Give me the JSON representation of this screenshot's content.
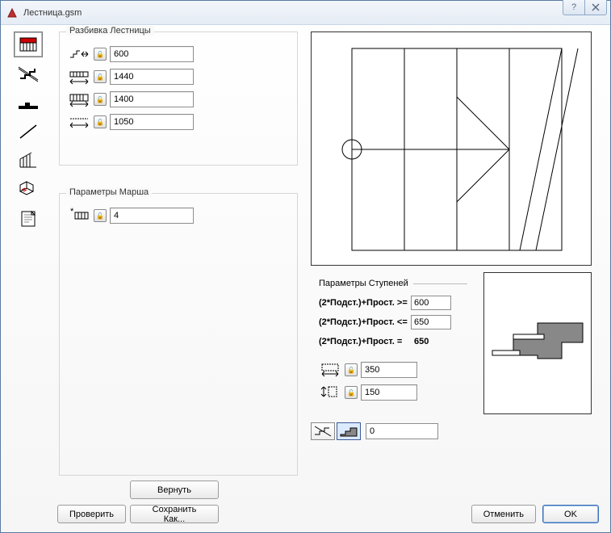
{
  "window": {
    "title": "Лестница.gsm"
  },
  "groups": {
    "breakdown_title": "Разбивка Лестницы",
    "march_title": "Параметры Марша",
    "step_title": "Параметры Ступеней"
  },
  "breakdown": {
    "v0": "600",
    "v1": "1440",
    "v2": "1400",
    "v3": "1050"
  },
  "march": {
    "count": "4"
  },
  "step_rules": {
    "rule_ge_label": "(2*Подст.)+Прост. >=",
    "rule_ge_val": "600",
    "rule_le_label": "(2*Подст.)+Прост. <=",
    "rule_le_val": "650",
    "rule_eq_label": "(2*Подст.)+Прост. =",
    "rule_eq_val": "650",
    "tread": "350",
    "riser": "150"
  },
  "offset": {
    "value": "0"
  },
  "buttons": {
    "revert": "Вернуть",
    "check": "Проверить",
    "saveas": "Сохранить Как...",
    "cancel": "Отменить",
    "ok": "OK"
  }
}
